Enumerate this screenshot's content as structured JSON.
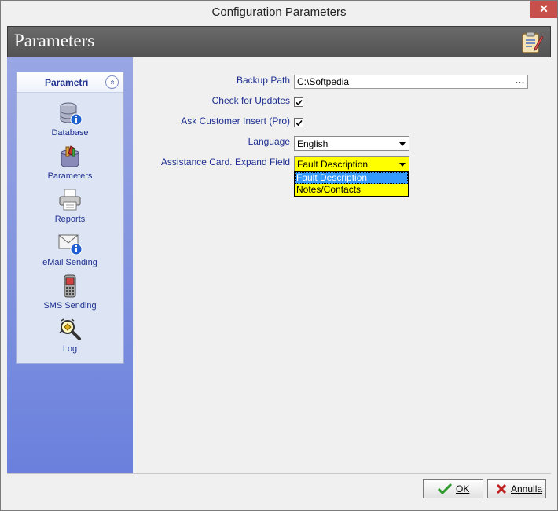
{
  "window": {
    "title": "Configuration Parameters",
    "close_glyph": "✕"
  },
  "header": {
    "title": "Parameters",
    "icon": "clipboard-pencil-icon"
  },
  "nav": {
    "header_label": "Parametri",
    "collapse_glyph": "»",
    "items": [
      {
        "label": "Database",
        "icon": "database-info-icon"
      },
      {
        "label": "Parameters",
        "icon": "parameters-icon"
      },
      {
        "label": "Reports",
        "icon": "printer-icon"
      },
      {
        "label": "eMail Sending",
        "icon": "email-info-icon"
      },
      {
        "label": "SMS Sending",
        "icon": "mobile-phone-icon"
      },
      {
        "label": "Log",
        "icon": "magnifier-log-icon"
      }
    ]
  },
  "form": {
    "backup_path": {
      "label": "Backup Path",
      "value": "C:\\Softpedia",
      "button": "..."
    },
    "check_updates": {
      "label": "Check for Updates",
      "checked": true
    },
    "ask_customer": {
      "label": "Ask Customer Insert (Pro)",
      "checked": true
    },
    "language": {
      "label": "Language",
      "value": "English"
    },
    "assistance": {
      "label": "Assistance Card. Expand Field",
      "value": "Fault Description",
      "options": [
        "Fault Description",
        "Notes/Contacts"
      ],
      "highlight_color": "#ffff00"
    }
  },
  "footer": {
    "ok_label": "OK",
    "cancel_label": "Annulla"
  },
  "colors": {
    "accent_text": "#1e2f8f",
    "header_band": "#5e5e5e",
    "nav_gradient_bottom": "#6a80dc"
  }
}
